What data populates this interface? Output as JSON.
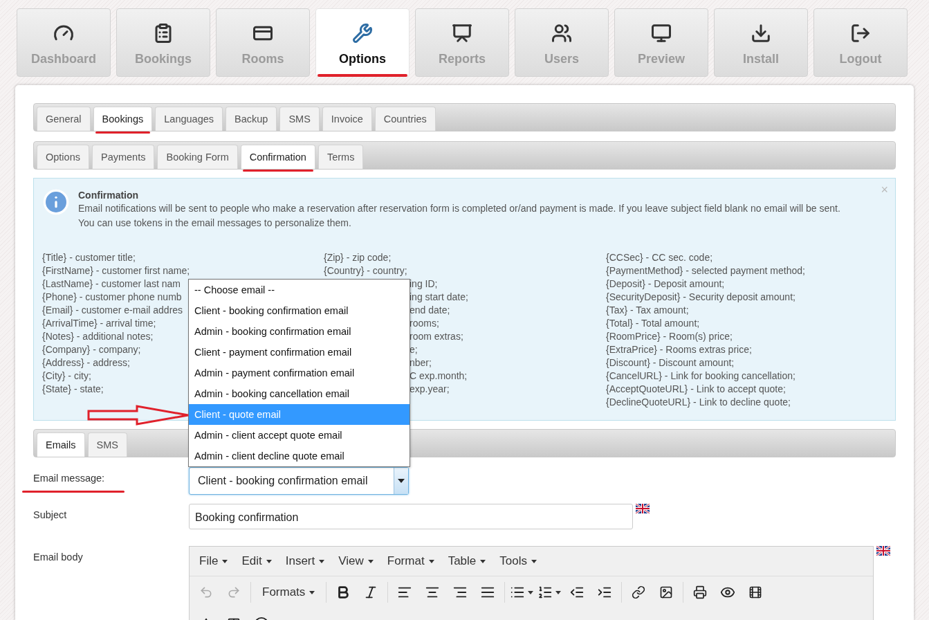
{
  "nav": [
    {
      "label": "Dashboard",
      "selected": false,
      "underlined": false
    },
    {
      "label": "Bookings",
      "selected": false,
      "underlined": false
    },
    {
      "label": "Rooms",
      "selected": false,
      "underlined": false
    },
    {
      "label": "Options",
      "selected": true,
      "underlined": true
    },
    {
      "label": "Reports",
      "selected": false,
      "underlined": false
    },
    {
      "label": "Users",
      "selected": false,
      "underlined": false
    },
    {
      "label": "Preview",
      "selected": false,
      "underlined": false
    },
    {
      "label": "Install",
      "selected": false,
      "underlined": false
    },
    {
      "label": "Logout",
      "selected": false,
      "underlined": false
    }
  ],
  "main_tabs": [
    {
      "label": "General",
      "selected": false,
      "underlined": false
    },
    {
      "label": "Bookings",
      "selected": true,
      "underlined": true
    },
    {
      "label": "Languages",
      "selected": false,
      "underlined": false
    },
    {
      "label": "Backup",
      "selected": false,
      "underlined": false
    },
    {
      "label": "SMS",
      "selected": false,
      "underlined": false
    },
    {
      "label": "Invoice",
      "selected": false,
      "underlined": false
    },
    {
      "label": "Countries",
      "selected": false,
      "underlined": false
    }
  ],
  "sub_tabs": [
    {
      "label": "Options",
      "selected": false,
      "underlined": false
    },
    {
      "label": "Payments",
      "selected": false,
      "underlined": false
    },
    {
      "label": "Booking Form",
      "selected": false,
      "underlined": false
    },
    {
      "label": "Confirmation",
      "selected": true,
      "underlined": true
    },
    {
      "label": "Terms",
      "selected": false,
      "underlined": false
    }
  ],
  "notice": {
    "title": "Confirmation",
    "close": "×",
    "lines": [
      "Email notifications will be sent to people who make a reservation after reservation form is completed or/and payment is made. If you leave subject field blank no email will be sent.",
      "You can use tokens in the email messages to personalize them."
    ],
    "token_columns": [
      {
        "items": [
          {
            "text": "{Title} - customer title;"
          },
          {
            "text": "{FirstName} - customer first name;"
          },
          {
            "text": "{LastName} - customer last nam"
          },
          {
            "text": "{Phone} - customer phone numb"
          },
          {
            "text": "{Email} - customer e-mail addres"
          },
          {
            "text": "{ArrivalTime} - arrival time;"
          },
          {
            "text": "{Notes} - additional notes;"
          },
          {
            "text": "{Company} - company;"
          },
          {
            "text": "{Address} - address;"
          },
          {
            "text": "{City} - city;"
          },
          {
            "text": "{State} - state;"
          }
        ]
      },
      {
        "items": [
          {
            "text": "{Zip} - zip code;",
            "kind": "full"
          },
          {
            "text": "{Country} - country;",
            "kind": "full"
          },
          {
            "text": "ing ID;",
            "kind": "cut"
          },
          {
            "text": "ing start date;",
            "kind": "cut"
          },
          {
            "text": "end date;",
            "kind": "cut"
          },
          {
            "text": "rooms;",
            "kind": "cut"
          },
          {
            "text": "room extras;",
            "kind": "cut"
          },
          {
            "text": "e;",
            "kind": "cut"
          },
          {
            "text": "nber;",
            "kind": "cut"
          },
          {
            "text": "C exp.month;",
            "kind": "cut"
          },
          {
            "text": "exp.year;",
            "kind": "cut"
          }
        ]
      },
      {
        "items": [
          {
            "text": "{CCSec} - CC sec. code;"
          },
          {
            "text": "{PaymentMethod} - selected payment method;"
          },
          {
            "text": "{Deposit} - Deposit amount;"
          },
          {
            "text": "{SecurityDeposit} - Security deposit amount;"
          },
          {
            "text": "{Tax} - Tax amount;"
          },
          {
            "text": "{Total} - Total amount;"
          },
          {
            "text": "{RoomPrice} - Room(s) price;"
          },
          {
            "text": "{ExtraPrice} - Rooms extras price;"
          },
          {
            "text": "{Discount} - Discount amount;"
          },
          {
            "text": "{CancelURL} - Link for booking cancellation;"
          },
          {
            "text": "{AcceptQuoteURL} - Link to accept quote;"
          },
          {
            "text": "{DeclineQuoteURL} - Link to decline quote;"
          }
        ]
      }
    ]
  },
  "email_tabs": [
    {
      "label": "Emails",
      "selected": true
    },
    {
      "label": "SMS",
      "selected": false
    }
  ],
  "dropdown": {
    "options": [
      {
        "label": "-- Choose email --",
        "selected": false
      },
      {
        "label": "Client - booking confirmation email",
        "selected": false
      },
      {
        "label": "Admin - booking confirmation email",
        "selected": false
      },
      {
        "label": "Client - payment confirmation email",
        "selected": false
      },
      {
        "label": "Admin - payment confirmation email",
        "selected": false
      },
      {
        "label": "Admin - booking cancellation email",
        "selected": false
      },
      {
        "label": "Client - quote email",
        "selected": true
      },
      {
        "label": "Admin - client accept quote email",
        "selected": false
      },
      {
        "label": "Admin - client decline quote email",
        "selected": false
      }
    ]
  },
  "form": {
    "email_message": {
      "label": "Email message:",
      "value": "Client - booking confirmation email",
      "underlined": true
    },
    "subject": {
      "label": "Subject",
      "value": "Booking confirmation"
    },
    "body": {
      "label": "Email body"
    }
  },
  "editor": {
    "menus": [
      "File",
      "Edit",
      "Insert",
      "View",
      "Format",
      "Table",
      "Tools"
    ],
    "formats": "Formats"
  }
}
